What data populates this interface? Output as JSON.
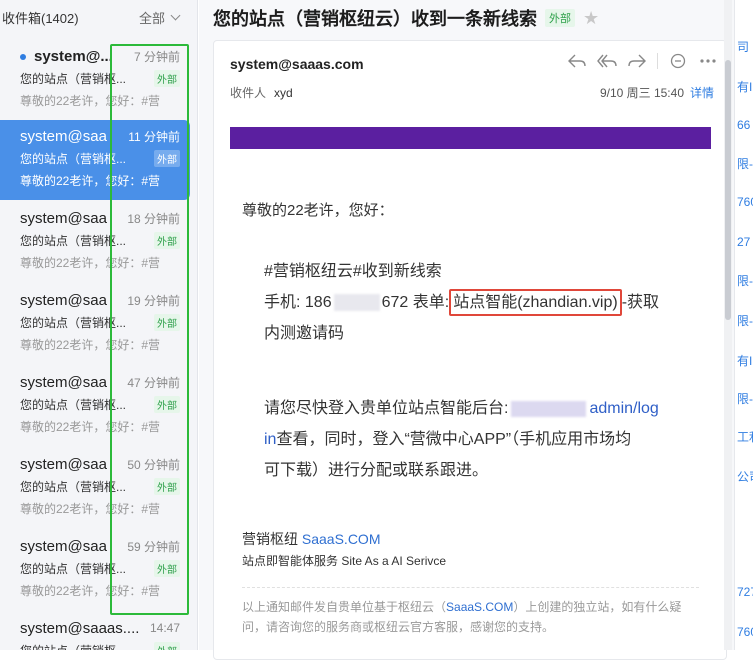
{
  "list": {
    "folder_title": "收件箱(1402)",
    "filter_label": "全部",
    "items": [
      {
        "sender": "system@...",
        "time": "7 分钟前",
        "subject": "您的站点（营销枢...",
        "tag": "外部",
        "preview": "尊敬的22老许，您好：#营",
        "unread": true
      },
      {
        "sender": "system@saa",
        "time": "11 分钟前",
        "subject": "您的站点（营销枢...",
        "tag": "外部",
        "preview": "尊敬的22老许，您好：#营"
      },
      {
        "sender": "system@saa",
        "time": "18 分钟前",
        "subject": "您的站点（营销枢...",
        "tag": "外部",
        "preview": "尊敬的22老许，您好：#营"
      },
      {
        "sender": "system@saa",
        "time": "19 分钟前",
        "subject": "您的站点（营销枢...",
        "tag": "外部",
        "preview": "尊敬的22老许，您好：#营"
      },
      {
        "sender": "system@saa",
        "time": "47 分钟前",
        "subject": "您的站点（营销枢...",
        "tag": "外部",
        "preview": "尊敬的22老许，您好：#营"
      },
      {
        "sender": "system@saa",
        "time": "50 分钟前",
        "subject": "您的站点（营销枢...",
        "tag": "外部",
        "preview": "尊敬的22老许，您好：#营"
      },
      {
        "sender": "system@saa",
        "time": "59 分钟前",
        "subject": "您的站点（营销枢...",
        "tag": "外部",
        "preview": "尊敬的22老许，您好：#营"
      },
      {
        "sender": "system@saaas....",
        "time": "14:47",
        "subject": "您的站点（营销枢...",
        "tag": "外部",
        "preview": ""
      }
    ]
  },
  "message": {
    "title": "您的站点（营销枢纽云）收到一条新线索",
    "title_tag": "外部",
    "from": "system@saaas.com",
    "recipient_label": "收件人",
    "recipient": "xyd",
    "date": "9/10 周三 15:40",
    "details_link": "详情",
    "toolbar_icons": [
      "reply-icon",
      "reply-all-icon",
      "forward-icon",
      "comment-icon",
      "more-icon"
    ],
    "greeting": "尊敬的22老许，您好：",
    "lead_heading": "#营销枢纽云#收到新线索",
    "phone_prefix": "手机: 186",
    "phone_suffix": "672 表单:",
    "form_name": "站点智能(zhandian.vip)",
    "form_trailing": "-获取",
    "form_line2": "内测邀请码",
    "login_prefix": "请您尽快登入贵单位站点智能后台:",
    "login_link_1": "admin/log",
    "login_link_2": "in",
    "login_rest_1": "查看，同时，登入“营微中心APP”（手机应用市场均",
    "login_rest_2": "可下载）进行分配或联系跟进。",
    "sig_name": "营销枢纽",
    "sig_brand": "SaaaS.COM",
    "sig_tagline": "站点即智能体服务 Site As a AI Serivce",
    "footer_1": "以上通知邮件发自贵单位基于枢纽云（",
    "footer_link": "SaaaS.COM",
    "footer_2": "）上创建的独立站，如有什么疑问，请咨询您的服务商或枢纽云官方客服，感谢您的支持。"
  },
  "right_strip": [
    "司",
    "有I",
    "66",
    "限-",
    "760",
    "27",
    "限-",
    "限-",
    "有I",
    "限-",
    "工利",
    "公司",
    "727",
    "760"
  ],
  "colors": {
    "accent": "#4a90e8",
    "banner": "#5b1fa0",
    "highlight_box": "#e0473a",
    "time_box": "#2cba3a",
    "tag_green": "#2fa14b"
  }
}
